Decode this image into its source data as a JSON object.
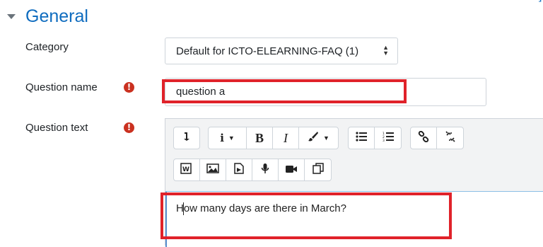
{
  "section": {
    "title": "General",
    "collapse_icon": "caret-down"
  },
  "top_link": "]",
  "fields": {
    "category": {
      "label": "Category",
      "value": "Default for ICTO-ELEARNING-FAQ (1)"
    },
    "question_name": {
      "label": "Question name",
      "value": "question a",
      "required_icon": "!"
    },
    "question_text": {
      "label": "Question text",
      "value": "How many days are there in March?",
      "required_icon": "!"
    }
  },
  "toolbar": {
    "row1": [
      [
        "toolbar-toggle"
      ],
      [
        "info",
        "bold",
        "italic",
        "brush"
      ],
      [
        "bullet-list",
        "numbered-list"
      ],
      [
        "link",
        "unlink"
      ]
    ],
    "row2": [
      [
        "word-paste",
        "image",
        "media",
        "microphone",
        "video",
        "copy-paste"
      ]
    ],
    "glyphs": {
      "bold": "B",
      "italic": "I"
    }
  },
  "colors": {
    "accent": "#0f6cbf",
    "required": "#ca3120",
    "highlight": "#e0222a"
  }
}
